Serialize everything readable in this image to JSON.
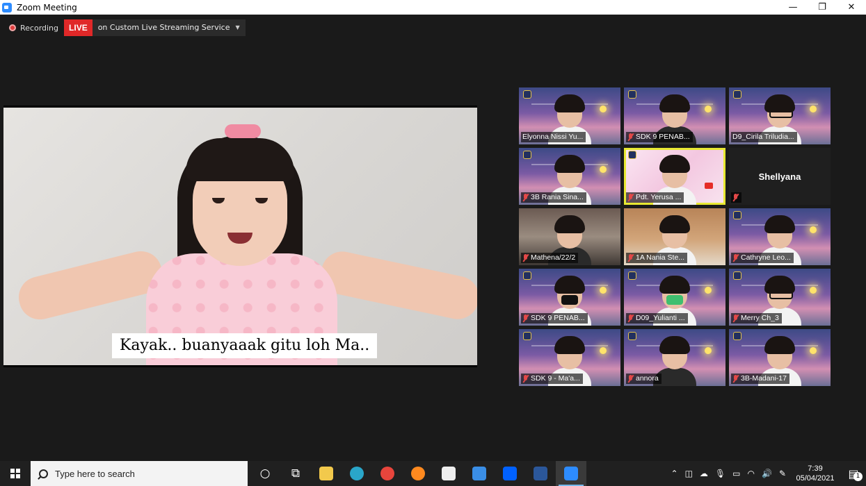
{
  "window": {
    "title": "Zoom Meeting",
    "controls": [
      "—",
      "❐",
      "✕"
    ]
  },
  "recording": {
    "label": "Recording",
    "live_badge": "LIVE",
    "stream_label": "on Custom Live Streaming Service",
    "stream_caret": "▼"
  },
  "speaker": {
    "caption": "Kayak.. buanyaaak gitu loh Ma.."
  },
  "gallery": {
    "tiles": [
      {
        "name": "Elyonna Nissi Yu...",
        "muted": false,
        "bg": "banner"
      },
      {
        "name": "SDK 9 PENAB...",
        "muted": true,
        "bg": "banner"
      },
      {
        "name": "D9_Cirila Triludia...",
        "muted": false,
        "bg": "banner"
      },
      {
        "name": "3B Rania Sina...",
        "muted": true,
        "bg": "banner"
      },
      {
        "name": "Pdt. Yerusa ...",
        "muted": true,
        "bg": "slide",
        "active": true
      },
      {
        "name": "Shellyana",
        "muted": true,
        "bg": "plain",
        "video_off": true
      },
      {
        "name": "Mathena/22/2",
        "muted": true,
        "bg": "room"
      },
      {
        "name": "1A Nania Ste...",
        "muted": true,
        "bg": "wood"
      },
      {
        "name": "Cathryne Leo...",
        "muted": true,
        "bg": "banner"
      },
      {
        "name": "SDK 9 PENAB...",
        "muted": true,
        "bg": "banner"
      },
      {
        "name": "D09_Yulianti ...",
        "muted": true,
        "bg": "banner"
      },
      {
        "name": "Merry Ch_3",
        "muted": true,
        "bg": "banner"
      },
      {
        "name": "SDK 9 - Ma'a...",
        "muted": true,
        "bg": "banner"
      },
      {
        "name": "annora",
        "muted": true,
        "bg": "banner"
      },
      {
        "name": "3B-Madani-17",
        "muted": true,
        "bg": "banner"
      }
    ]
  },
  "taskbar": {
    "search_placeholder": "Type here to search",
    "apps": [
      {
        "name": "cortana",
        "glyph": "○"
      },
      {
        "name": "task-view",
        "glyph": "⧉"
      },
      {
        "name": "file-explorer",
        "color": "#f2c94c"
      },
      {
        "name": "edge",
        "color": "#2aa6c9"
      },
      {
        "name": "chrome",
        "color": "#e8453c"
      },
      {
        "name": "firefox",
        "color": "#ff8a1f"
      },
      {
        "name": "amazon",
        "color": "#eeeeee"
      },
      {
        "name": "mail",
        "color": "#3a8ee6"
      },
      {
        "name": "dropbox",
        "color": "#0061ff"
      },
      {
        "name": "word",
        "color": "#2b579a"
      },
      {
        "name": "zoom",
        "color": "#2d8cff"
      }
    ],
    "clock_time": "7:39",
    "clock_date": "05/04/2021",
    "notification_count": "1"
  }
}
